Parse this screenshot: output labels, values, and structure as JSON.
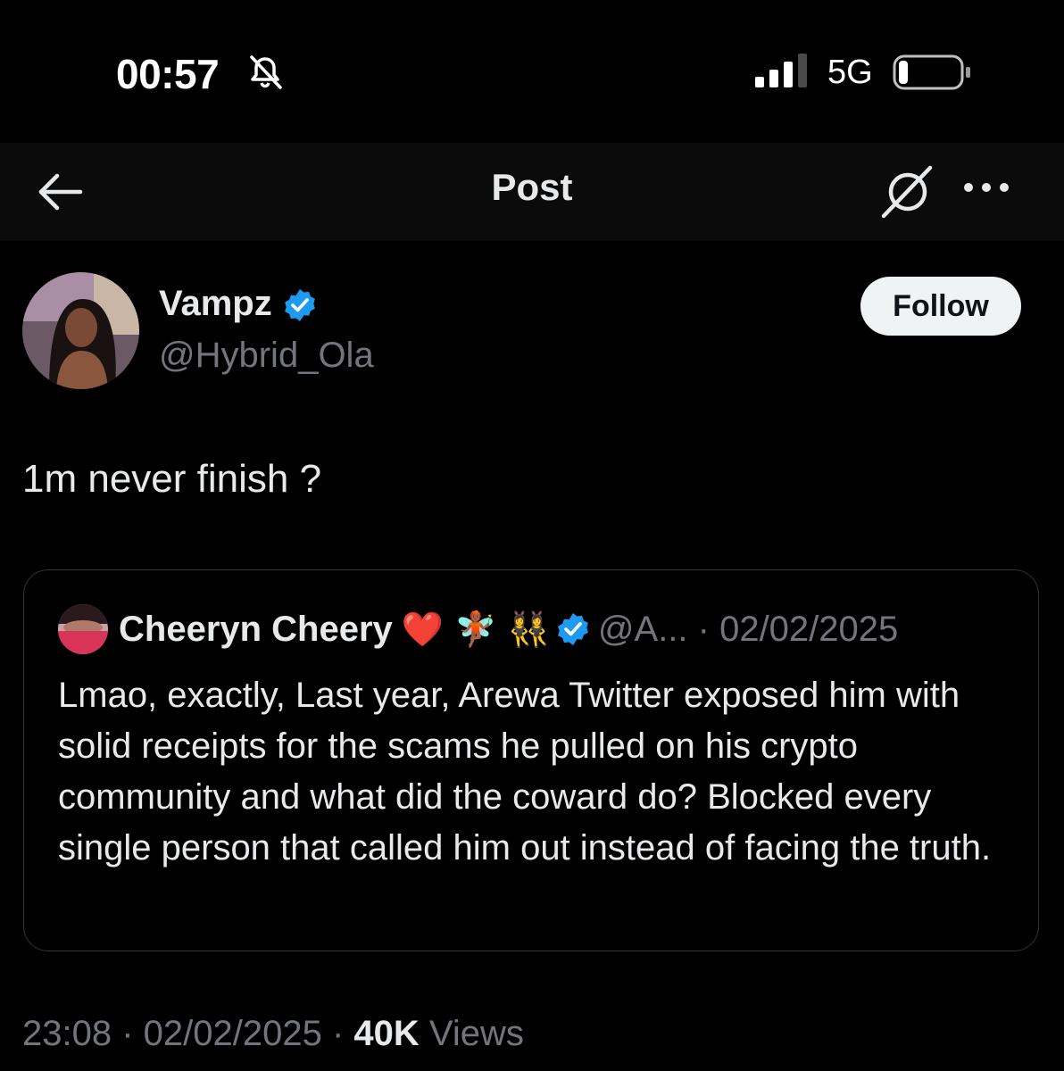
{
  "status_bar": {
    "time": "00:57",
    "network": "5G",
    "icons": [
      "bell-slash-icon",
      "signal-icon",
      "battery-icon"
    ]
  },
  "nav": {
    "title": "Post",
    "icons": [
      "back-arrow-icon",
      "grok-icon",
      "more-icon"
    ]
  },
  "author": {
    "name": "Vampz",
    "handle": "@Hybrid_Ola",
    "verified": true,
    "follow_label": "Follow"
  },
  "post": {
    "text": "1m never finish ?"
  },
  "quote": {
    "name": "Cheeryn Cheery",
    "emojis": "❤️ 🧚🏾 👯‍♀️",
    "verified": true,
    "handle_date": "@A... · 02/02/2025",
    "text": "Lmao, exactly, Last year, Arewa Twitter exposed him with solid receipts for the scams he pulled on his crypto community and what did the coward do? Blocked every single person that called him out instead of facing the truth."
  },
  "meta": {
    "time_date": "23:08 · 02/02/2025 · ",
    "views_count": "40K",
    "views_label": " Views"
  },
  "colors": {
    "background": "#000000",
    "text": "#e7e9ea",
    "muted": "#71767b",
    "verified": "#1d9bf0",
    "border": "#2f3336"
  }
}
